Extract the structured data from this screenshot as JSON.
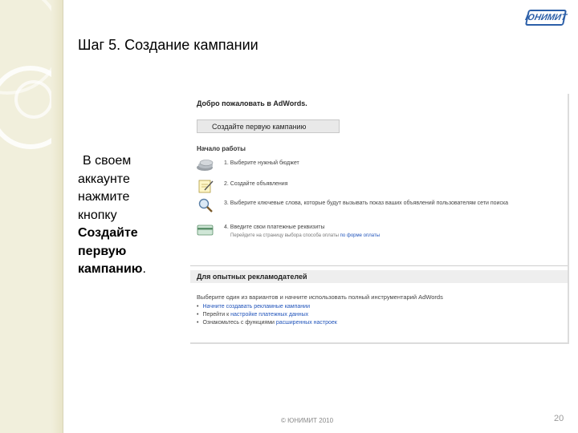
{
  "slide": {
    "title": "Шаг 5. Создание кампании",
    "logo_text": "ЮНИМИТ",
    "instruction_line1": "В своем",
    "instruction_line2": "аккаунте",
    "instruction_line3": "нажмите",
    "instruction_line4": "кнопку",
    "instruction_bold1": "Создайте",
    "instruction_bold2": "первую",
    "instruction_bold3": "кампанию",
    "instruction_end": ".",
    "footer": "© ЮНИМИТ 2010",
    "page_number": "20"
  },
  "adwords": {
    "welcome": "Добро пожаловать в AdWords.",
    "create_button": "Создайте первую кампанию",
    "getting_started": "Начало работы",
    "steps": [
      {
        "text": "1. Выберите нужный бюджет",
        "icon": "coins-icon"
      },
      {
        "text": "2. Создайте объявления",
        "icon": "note-icon"
      },
      {
        "text": "3. Выберите ключевые слова, которые будут вызывать показ ваших объявлений пользователям сети поиска",
        "icon": "magnifier-icon"
      },
      {
        "text": "4. Введите свои платежные реквизиты",
        "icon": "card-icon",
        "sub": "Перейдите на страницу выбора способа оплаты",
        "sub_link": "по форме оплаты"
      }
    ],
    "advanced_head": "Для опытных рекламодателей",
    "advanced_intro": "Выберите один из вариантов и начните использовать полный инструментарий AdWords",
    "advanced_items": [
      {
        "text": "Начните создавать рекламные кампании",
        "link": ""
      },
      {
        "text": "Перейти к ",
        "link": "настройке платежных данных"
      },
      {
        "text": "Ознакомьтесь с функциями ",
        "link": "расширенных настроек"
      }
    ]
  },
  "colors": {
    "strip": "#f1efdc",
    "logo": "#2c5fa8",
    "link": "#2255bb"
  }
}
